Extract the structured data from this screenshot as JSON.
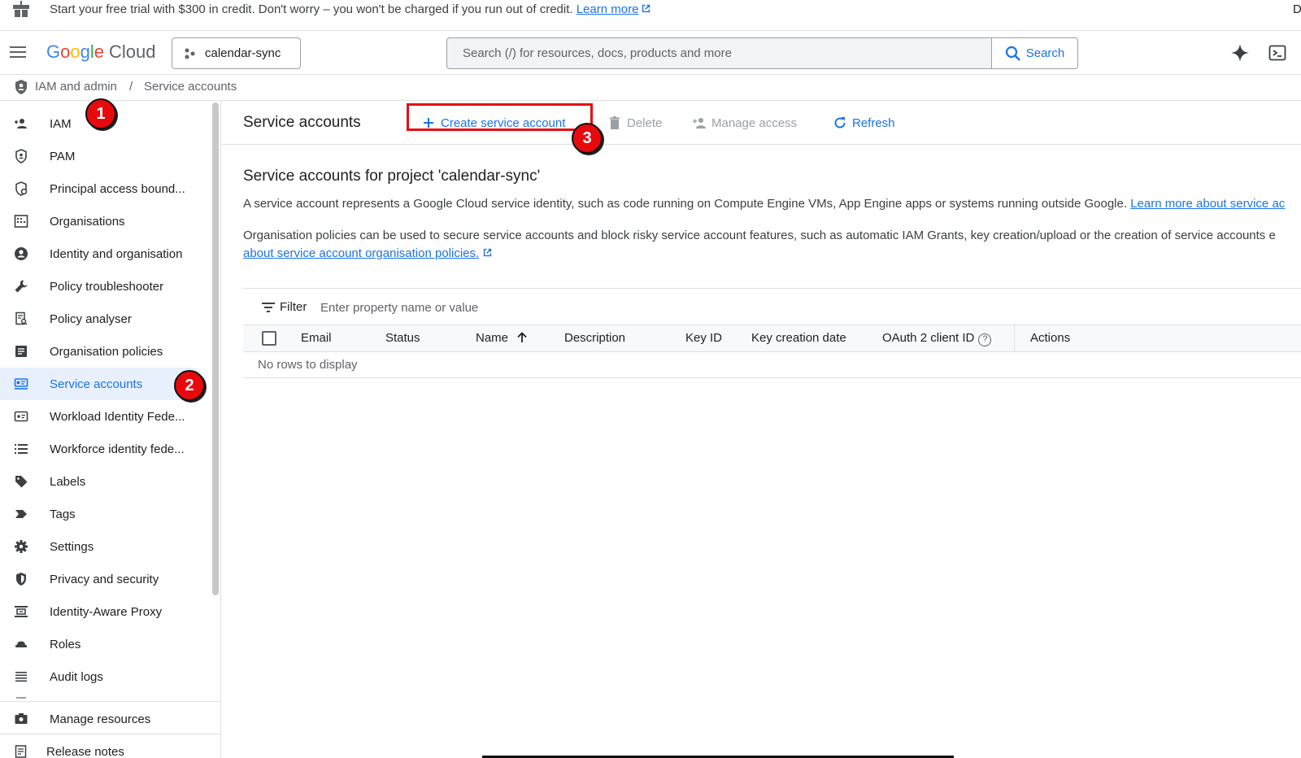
{
  "banner": {
    "message": "Start your free trial with $300 in credit. Don't worry – you won't be charged if you run out of credit.",
    "learn_more": "Learn more",
    "user_initial": "D"
  },
  "header": {
    "logo_google": [
      "G",
      "o",
      "o",
      "g",
      "l",
      "e"
    ],
    "logo_cloud": "Cloud",
    "project": "calendar-sync",
    "search_placeholder": "Search (/) for resources, docs, products and more",
    "search_button": "Search"
  },
  "breadcrumb": {
    "parent": "IAM and admin",
    "separator": "/",
    "current": "Service accounts"
  },
  "sidebar": {
    "items": [
      {
        "label": "IAM",
        "icon": "person-add-icon"
      },
      {
        "label": "PAM",
        "icon": "shield-person-icon"
      },
      {
        "label": "Principal access bound...",
        "icon": "policy-boundary-icon"
      },
      {
        "label": "Organisations",
        "icon": "organisation-icon"
      },
      {
        "label": "Identity and organisation",
        "icon": "account-circle-icon"
      },
      {
        "label": "Policy troubleshooter",
        "icon": "wrench-icon"
      },
      {
        "label": "Policy analyser",
        "icon": "document-search-icon"
      },
      {
        "label": "Organisation policies",
        "icon": "list-document-icon"
      },
      {
        "label": "Service accounts",
        "icon": "service-account-icon"
      },
      {
        "label": "Workload Identity Fede...",
        "icon": "id-card-icon"
      },
      {
        "label": "Workforce identity fede...",
        "icon": "list-icon"
      },
      {
        "label": "Labels",
        "icon": "label-tag-icon"
      },
      {
        "label": "Tags",
        "icon": "tag-arrow-icon"
      },
      {
        "label": "Settings",
        "icon": "gear-icon"
      },
      {
        "label": "Privacy and security",
        "icon": "shield-icon"
      },
      {
        "label": "Identity-Aware Proxy",
        "icon": "proxy-icon"
      },
      {
        "label": "Roles",
        "icon": "roles-hat-icon"
      },
      {
        "label": "Audit logs",
        "icon": "lines-icon"
      }
    ],
    "manage_resources": "Manage resources",
    "release_notes": "Release notes"
  },
  "toolbar": {
    "title": "Service accounts",
    "create": "Create service account",
    "delete": "Delete",
    "manage_access": "Manage access",
    "refresh": "Refresh"
  },
  "content": {
    "section_title": "Service accounts for project 'calendar-sync'",
    "para1_text": "A service account represents a Google Cloud service identity, such as code running on Compute Engine VMs, App Engine apps or systems running outside Google.",
    "para1_link": "Learn more about service ac",
    "para2_text": "Organisation policies can be used to secure service accounts and block risky service account features, such as automatic IAM Grants, key creation/upload or the creation of service accounts e",
    "para2_link": "about service account organisation policies."
  },
  "table": {
    "filter_label": "Filter",
    "filter_placeholder": "Enter property name or value",
    "columns": [
      "Email",
      "Status",
      "Name",
      "Description",
      "Key ID",
      "Key creation date",
      "OAuth 2 client ID",
      "Actions"
    ],
    "sorted_column": "Name",
    "empty_message": "No rows to display"
  },
  "callouts": [
    "1",
    "2",
    "3"
  ],
  "colors": {
    "accent": "#1a73e8",
    "callout": "#e8090d",
    "active_bg": "#e8f0fe"
  }
}
